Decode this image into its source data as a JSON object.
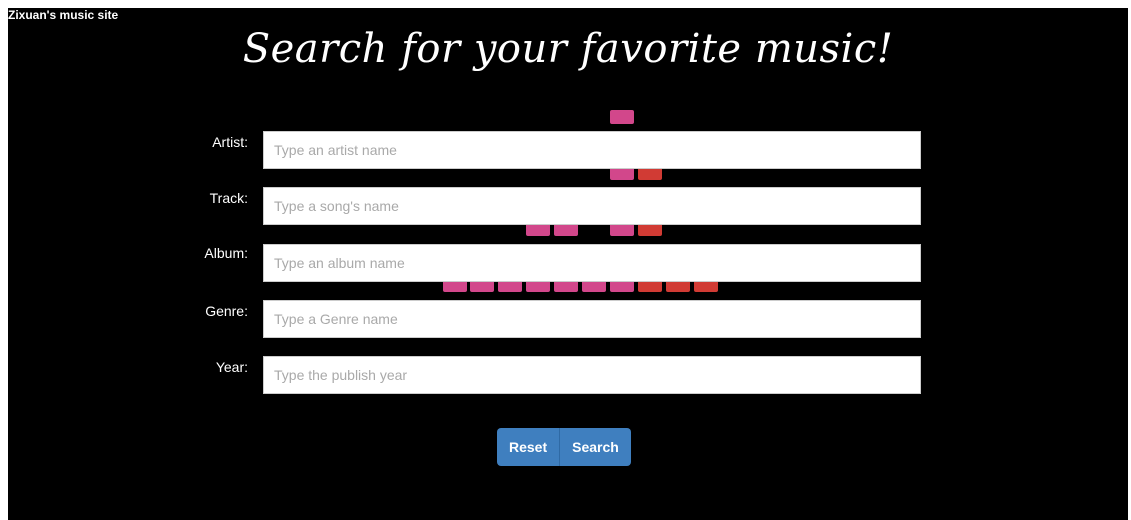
{
  "site": {
    "title": "Zixuan's music site",
    "heading": "Search for your favorite music!"
  },
  "form": {
    "fields": [
      {
        "label": "Artist:",
        "placeholder": "Type an artist name",
        "value": ""
      },
      {
        "label": "Track:",
        "placeholder": "Type a song's name",
        "value": ""
      },
      {
        "label": "Album:",
        "placeholder": "Type an album name",
        "value": ""
      },
      {
        "label": "Genre:",
        "placeholder": "Type a Genre name",
        "value": ""
      },
      {
        "label": "Year:",
        "placeholder": "Type the publish year",
        "value": ""
      }
    ],
    "buttons": {
      "reset_label": "Reset",
      "search_label": "Search"
    }
  },
  "colors": {
    "background": "#000000",
    "button": "#3f7fbf",
    "equalizer_pink": "#e94f9a",
    "equalizer_red": "#e8413a"
  }
}
